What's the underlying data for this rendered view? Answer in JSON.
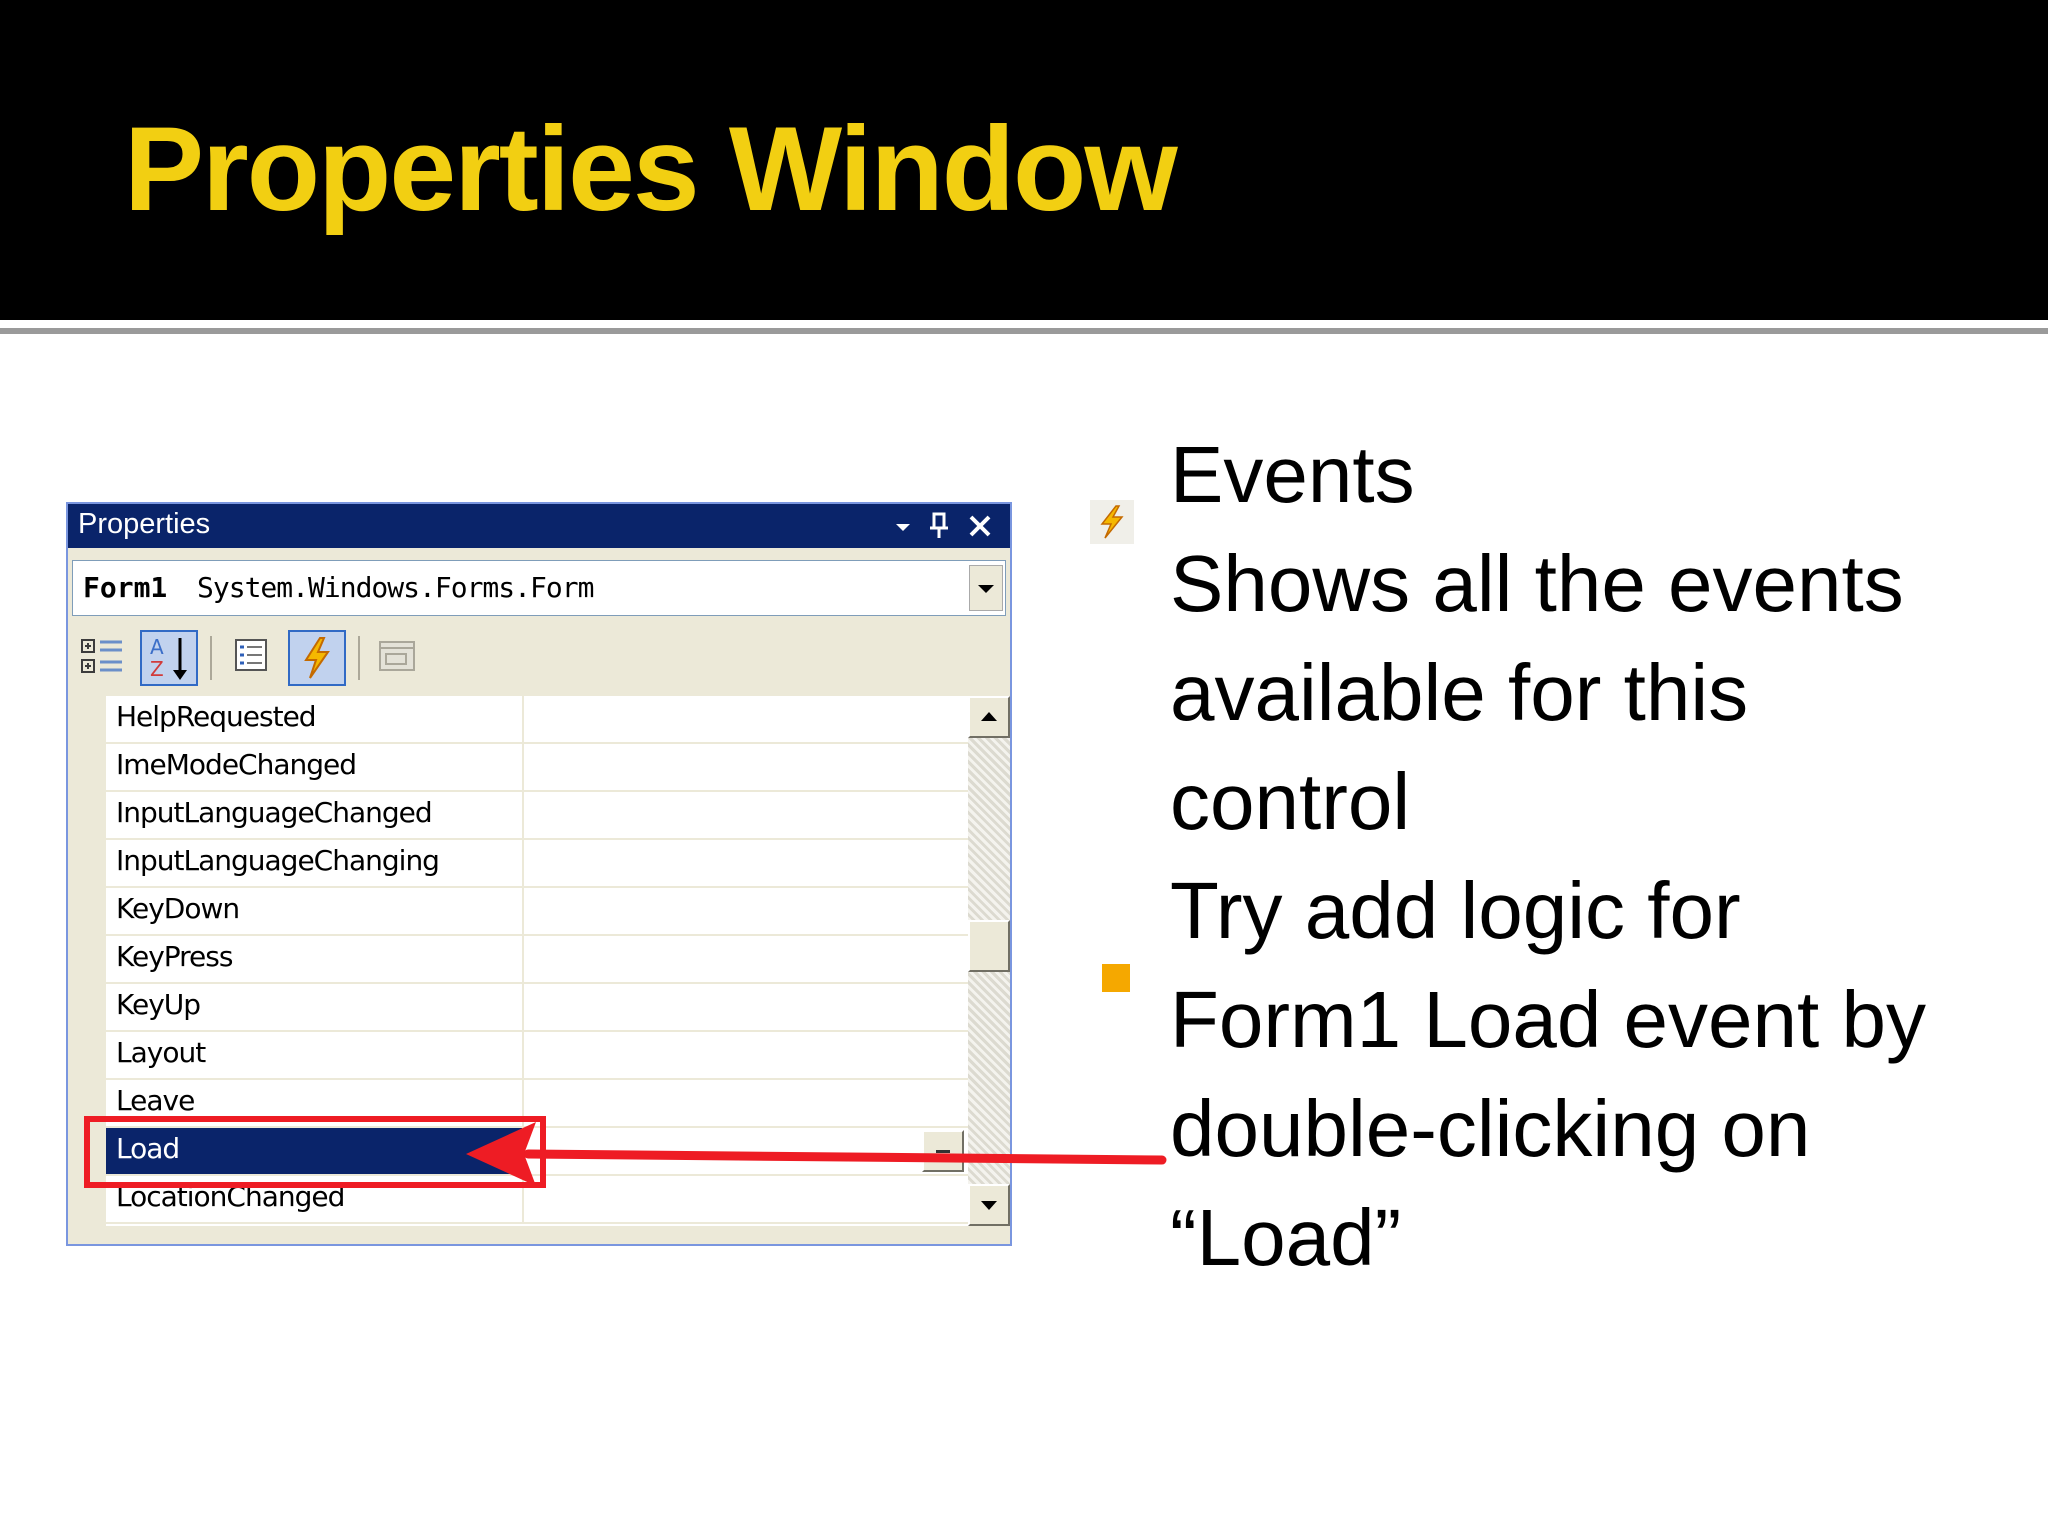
{
  "slide": {
    "title": "Properties Window",
    "title_color": "#f2cf12"
  },
  "properties_window": {
    "caption": "Properties",
    "caption_buttons": [
      "dropdown-arrow-icon",
      "pin-icon",
      "close-icon"
    ],
    "object_name": "Form1",
    "object_type": "System.Windows.Forms.Form",
    "toolbar": [
      "categorized-icon",
      "alphabetical-icon",
      "properties-icon",
      "events-icon",
      "property-pages-icon"
    ],
    "active_toolbar_buttons": [
      "alphabetical",
      "events"
    ],
    "events": [
      "HelpRequested",
      "ImeModeChanged",
      "InputLanguageChanged",
      "InputLanguageChanging",
      "KeyDown",
      "KeyPress",
      "KeyUp",
      "Layout",
      "Leave",
      "Load",
      "LocationChanged"
    ],
    "selected_event": "Load",
    "selection_color": "#0a246a",
    "caption_color": "#0a246a",
    "highlight_color": "#ee1c24"
  },
  "bullets": [
    {
      "marker": "events-icon",
      "lines": [
        "Events",
        "Shows all the events",
        "available for this",
        "control"
      ]
    },
    {
      "marker": "square",
      "marker_color": "#f5a800",
      "lines": [
        "Try add logic for",
        "Form1 Load event by",
        "double-clicking on",
        "“Load”"
      ]
    }
  ]
}
